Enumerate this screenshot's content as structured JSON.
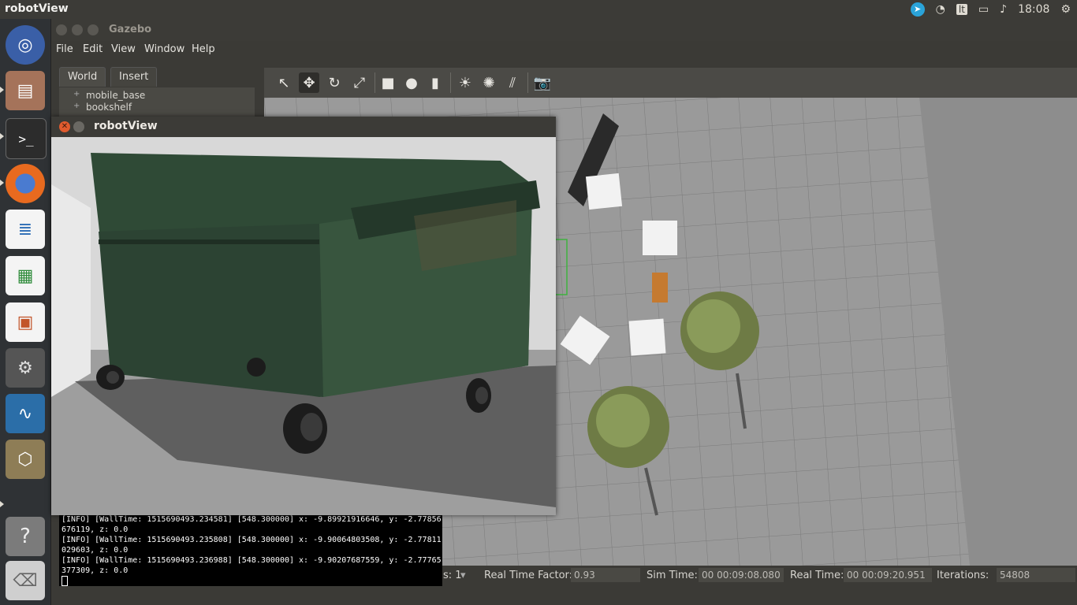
{
  "topbar": {
    "app_title": "robotView",
    "clock": "18:08",
    "keyboard_layout": "lt"
  },
  "launcher": {
    "items": [
      "dash-home",
      "files",
      "terminal",
      "firefox",
      "writer",
      "calc",
      "impress",
      "system-settings",
      "system-monitor",
      "installer",
      "help",
      "trash"
    ]
  },
  "gazebo": {
    "title": "Gazebo",
    "menu": [
      "File",
      "Edit",
      "View",
      "Window",
      "Help"
    ],
    "tabs": [
      "World",
      "Insert"
    ],
    "tree": [
      "mobile_base",
      "bookshelf"
    ],
    "bottom": {
      "steps_suffix": "s: 1",
      "real_time_factor_label": "Real Time Factor:",
      "real_time_factor": "0.93",
      "sim_time_label": "Sim Time:",
      "sim_time": "00 00:09:08.080",
      "real_time_label": "Real Time:",
      "real_time": "00 00:09:20.951",
      "iterations_label": "Iterations:",
      "iterations": "54808"
    }
  },
  "terminal": {
    "lines": [
      "[INFO] [WallTime: 1515690493.234581] [548.300000] x: -9.89921916646, y: -2.77856",
      "676119, z: 0.0",
      "[INFO] [WallTime: 1515690493.235808] [548.300000] x: -9.90064803508, y: -2.77811",
      "029603, z: 0.0",
      "[INFO] [WallTime: 1515690493.236988] [548.300000] x: -9.90207687559, y: -2.77765",
      "377309, z: 0.0"
    ]
  },
  "robot_view": {
    "title": "robotView"
  },
  "colors": {
    "dumpster": "#2f4a36",
    "ground": "#9e9e9e",
    "close_button": "#e05b2e"
  }
}
